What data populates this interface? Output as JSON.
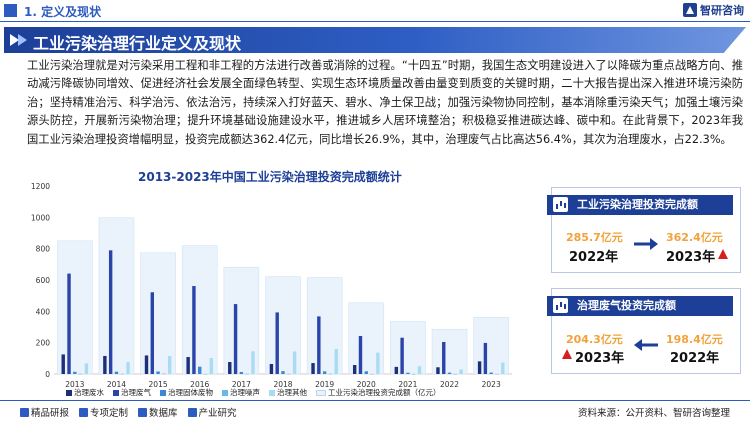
{
  "header": {
    "section": "1. 定义及现状",
    "brand": "智研咨询"
  },
  "banner": {
    "title": "工业污染治理行业定义及现状"
  },
  "paragraph": "工业污染治理就是对污染采用工程和非工程的方法进行改善或消除的过程。“十四五”时期，我国生态文明建设进入了以降碳为重点战略方向、推动减污降碳协同增效、促进经济社会发展全面绿色转型、实现生态环境质量改善由量变到质变的关键时期，二十大报告提出深入推进环境污染防治；坚持精准治污、科学治污、依法治污，持续深入打好蓝天、碧水、净土保卫战；加强污染物协同控制，基本消除重污染天气；加强土壤污染源头防控，开展新污染物治理；提升环境基础设施建设水平，推进城乡人居环境整治；积极稳妥推进碳达峰、碳中和。在此背景下，2023年我国工业污染治理投资增幅明显，投资完成额达362.4亿元，同比增长26.9%，其中，治理废气占比高达56.4%，其次为治理废水，占22.3%。",
  "chart_data": {
    "type": "bar",
    "title": "2013-2023年中国工业污染治理投资完成额统计",
    "categories": [
      "2013",
      "2014",
      "2015",
      "2016",
      "2017",
      "2018",
      "2019",
      "2020",
      "2021",
      "2022",
      "2023"
    ],
    "ylim": [
      0,
      1200
    ],
    "yticks": [
      0,
      200,
      400,
      600,
      800,
      1000,
      1200
    ],
    "series": [
      {
        "name": "治理废水",
        "color": "#1d2f78",
        "values": [
          124.9,
          115.2,
          118.4,
          108.2,
          76.4,
          64.0,
          69.9,
          57.4,
          45.4,
          42.9,
          80.8
        ]
      },
      {
        "name": "治理废气",
        "color": "#2b44a8",
        "values": [
          640.9,
          789.4,
          521.8,
          561.5,
          446.3,
          393.1,
          367.7,
          242.4,
          231.6,
          204.3,
          198.4
        ]
      },
      {
        "name": "治理固体废物",
        "color": "#3b88d6",
        "values": [
          14.0,
          15.0,
          16.1,
          46.7,
          12.7,
          18.4,
          17.0,
          17.3,
          8.1,
          8.6,
          9.4
        ]
      },
      {
        "name": "治理噪声",
        "color": "#69b9e3",
        "values": [
          1.8,
          1.1,
          2.8,
          0.6,
          1.3,
          1.5,
          1.4,
          0.8,
          0.7,
          0.5,
          0.6
        ]
      },
      {
        "name": "治理其他",
        "color": "#a9dcf4",
        "values": [
          68.1,
          76.2,
          114.3,
          102.2,
          144.8,
          144.1,
          159.1,
          136.3,
          49.7,
          29.5,
          73.2
        ]
      }
    ],
    "total": {
      "name": "工业污染治理投资完成额（亿元）",
      "values": [
        849.7,
        997.7,
        773.7,
        819.0,
        681.5,
        621.2,
        615.2,
        454.3,
        335.2,
        285.7,
        362.4
      ]
    }
  },
  "cards": [
    {
      "title": "工业污染治理投资完成额",
      "left_value": "285.7亿元",
      "left_year": "2022年",
      "right_value": "362.4亿元",
      "right_year": "2023年"
    },
    {
      "title": "治理废气投资完成额",
      "left_value": "204.3亿元",
      "left_year": "2023年",
      "right_value": "198.4亿元",
      "right_year": "2022年"
    }
  ],
  "footer": {
    "item1": "精品研报",
    "item2": "专项定制",
    "item3": "数据库",
    "item4": "产业研究",
    "source": "资料来源：公开资料、智研咨询整理"
  },
  "colors": {
    "primary": "#1d3f97",
    "accent": "#f2a23a",
    "up": "#d62020"
  }
}
